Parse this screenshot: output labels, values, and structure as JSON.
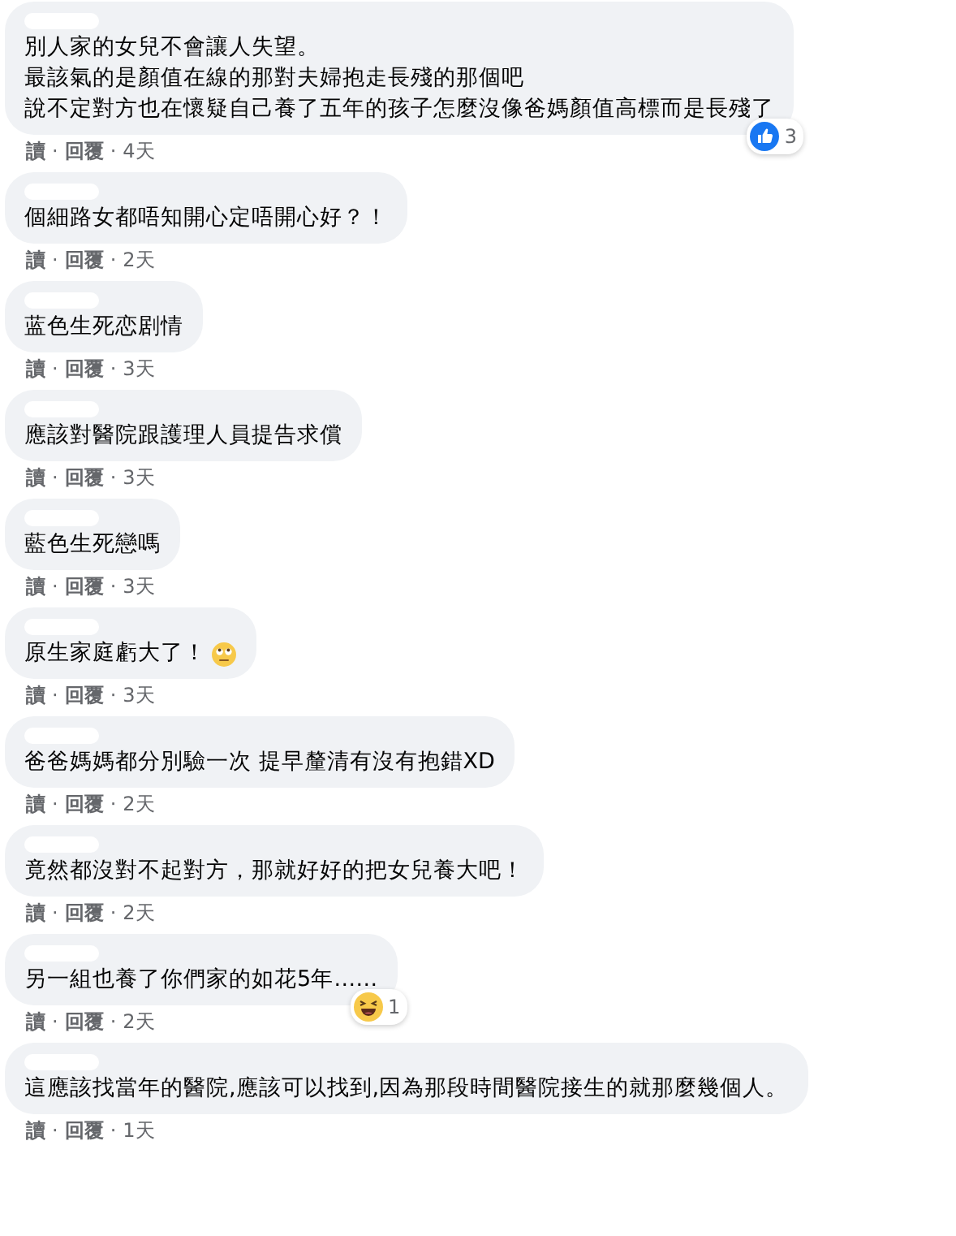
{
  "comments": [
    {
      "lines": [
        "別人家的女兒不會讓人失望。",
        "最該氣的是顏值在線的那對夫婦抱走長殘的那個吧",
        "說不定對方也在懷疑自己養了五年的孩子怎麼沒像爸媽顏值高標而是長殘了"
      ],
      "reaction": {
        "kind": "like",
        "count": "3"
      },
      "footer": [
        {
          "kind": "link",
          "text": "讀"
        },
        {
          "kind": "sep",
          "text": "·"
        },
        {
          "kind": "link",
          "text": "回覆"
        },
        {
          "kind": "sep",
          "text": "·"
        },
        {
          "kind": "time",
          "text": "4天"
        }
      ]
    },
    {
      "lines": [
        "個細路女都唔知開心定唔開心好？！"
      ],
      "footer": [
        {
          "kind": "link",
          "text": "讀"
        },
        {
          "kind": "sep",
          "text": "·"
        },
        {
          "kind": "link",
          "text": "回覆"
        },
        {
          "kind": "sep",
          "text": "·"
        },
        {
          "kind": "time",
          "text": "2天"
        }
      ]
    },
    {
      "lines": [
        "蓝色生死恋剧情"
      ],
      "footer": [
        {
          "kind": "link",
          "text": "讀"
        },
        {
          "kind": "sep",
          "text": "·"
        },
        {
          "kind": "link",
          "text": "回覆"
        },
        {
          "kind": "sep",
          "text": "·"
        },
        {
          "kind": "time",
          "text": "3天"
        }
      ]
    },
    {
      "lines": [
        "應該對醫院跟護理人員提告求償"
      ],
      "footer": [
        {
          "kind": "link",
          "text": "讀"
        },
        {
          "kind": "sep",
          "text": "·"
        },
        {
          "kind": "link",
          "text": "回覆"
        },
        {
          "kind": "sep",
          "text": "·"
        },
        {
          "kind": "time",
          "text": "3天"
        }
      ]
    },
    {
      "lines": [
        "藍色生死戀嗎"
      ],
      "footer": [
        {
          "kind": "link",
          "text": "讀"
        },
        {
          "kind": "sep",
          "text": "·"
        },
        {
          "kind": "link",
          "text": "回覆"
        },
        {
          "kind": "sep",
          "text": "·"
        },
        {
          "kind": "time",
          "text": "3天"
        }
      ]
    },
    {
      "lines": [
        "原生家庭虧大了！"
      ],
      "emoji": {
        "kind": "eyeroll"
      },
      "footer": [
        {
          "kind": "link",
          "text": "讀"
        },
        {
          "kind": "sep",
          "text": "·"
        },
        {
          "kind": "link",
          "text": "回覆"
        },
        {
          "kind": "sep",
          "text": "·"
        },
        {
          "kind": "time",
          "text": "3天"
        }
      ]
    },
    {
      "lines": [
        "爸爸媽媽都分別驗一次 提早釐清有沒有抱錯XD"
      ],
      "footer": [
        {
          "kind": "link",
          "text": "讀"
        },
        {
          "kind": "sep",
          "text": "·"
        },
        {
          "kind": "link",
          "text": "回覆"
        },
        {
          "kind": "sep",
          "text": "·"
        },
        {
          "kind": "time",
          "text": "2天"
        }
      ]
    },
    {
      "lines": [
        "竟然都沒對不起對方，那就好好的把女兒養大吧！"
      ],
      "footer": [
        {
          "kind": "link",
          "text": "讀"
        },
        {
          "kind": "sep",
          "text": "·"
        },
        {
          "kind": "link",
          "text": "回覆"
        },
        {
          "kind": "sep",
          "text": "·"
        },
        {
          "kind": "time",
          "text": "2天"
        }
      ]
    },
    {
      "lines": [
        "另一組也養了你們家的如花5年……"
      ],
      "reaction": {
        "kind": "haha",
        "count": "1"
      },
      "footer": [
        {
          "kind": "link",
          "text": "讀"
        },
        {
          "kind": "sep",
          "text": "·"
        },
        {
          "kind": "link",
          "text": "回覆"
        },
        {
          "kind": "sep",
          "text": "·"
        },
        {
          "kind": "time",
          "text": "2天"
        }
      ]
    },
    {
      "lines": [
        "這應該找當年的醫院,應該可以找到,因為那段時間醫院接生的就那麼幾個人。"
      ],
      "footer": [
        {
          "kind": "link",
          "text": "讀"
        },
        {
          "kind": "sep",
          "text": "·"
        },
        {
          "kind": "link",
          "text": "回覆"
        },
        {
          "kind": "sep",
          "text": "·"
        },
        {
          "kind": "time",
          "text": "1天"
        }
      ]
    }
  ]
}
